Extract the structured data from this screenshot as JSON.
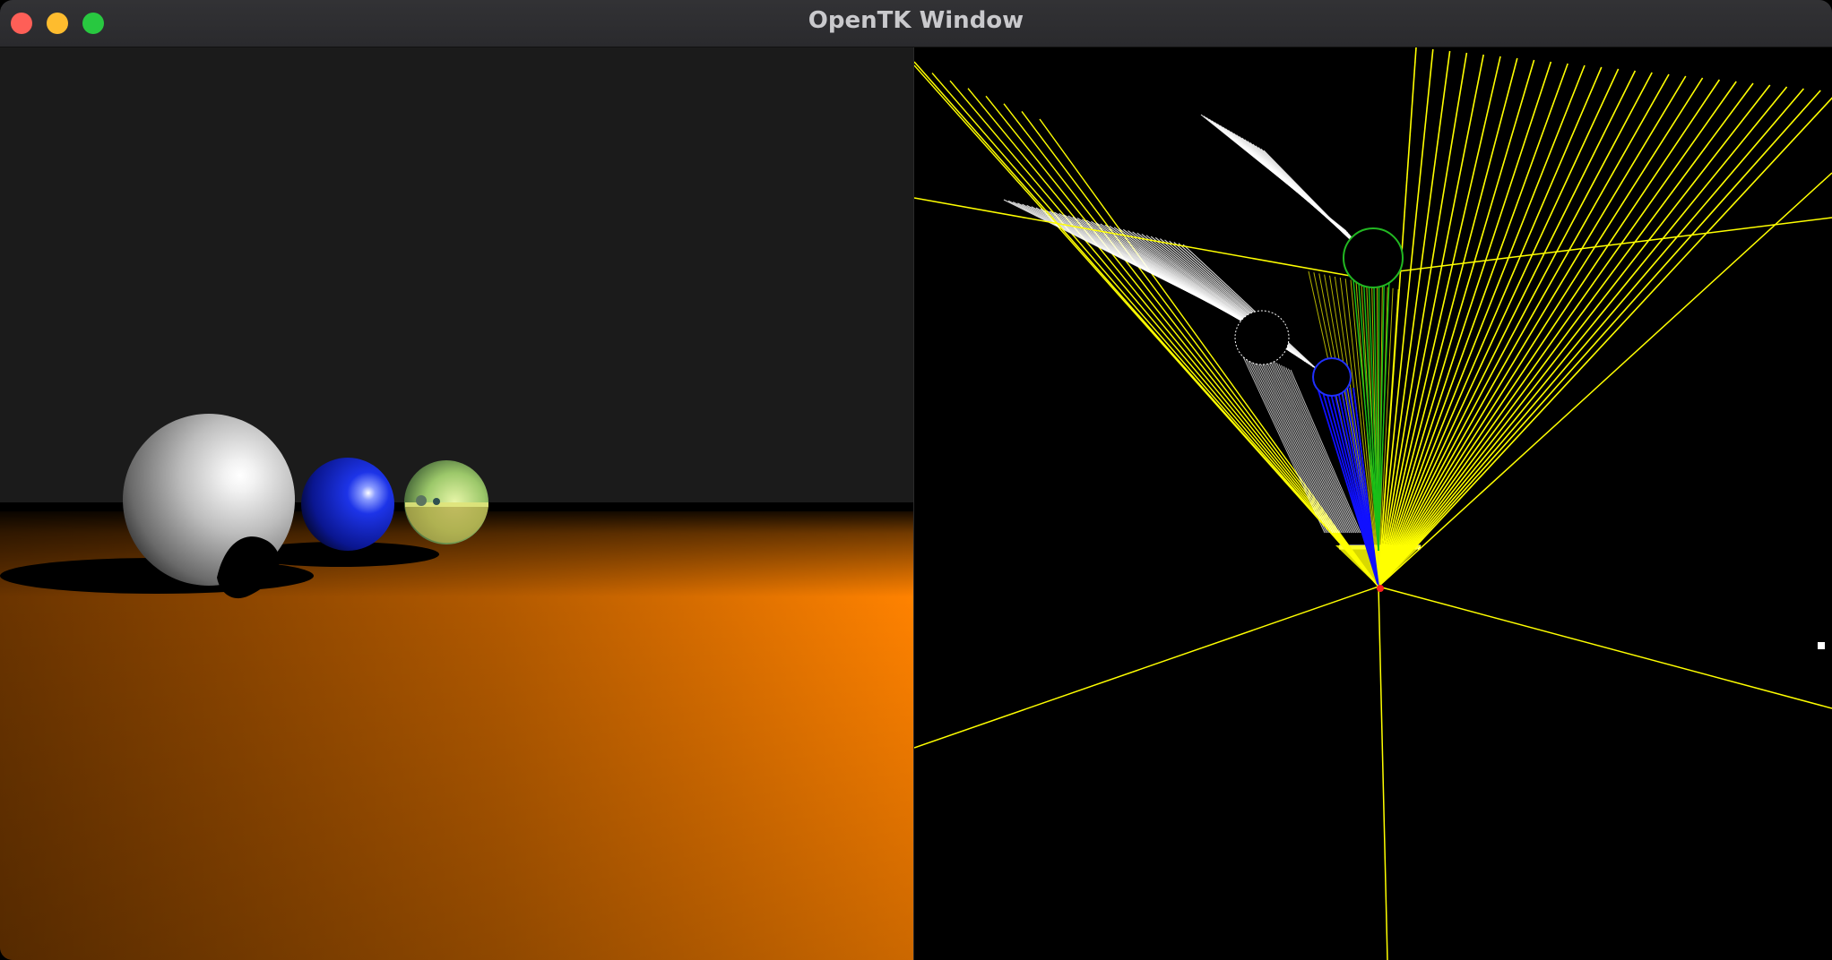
{
  "window": {
    "title": "OpenTK Window",
    "controls": [
      "close",
      "minimize",
      "zoom"
    ]
  },
  "scene": {
    "left_panel": "raytraced-render",
    "right_panel": "ray-debug-view",
    "colors": {
      "background": "#1b1b1b",
      "floor_light": "#ff8000",
      "floor_dark": "#6b3500",
      "sphere_white": "#e6e6e6",
      "sphere_blue": "#0a1fd6",
      "sphere_reflective": "#a9d07a",
      "ray_primary": "#ffff00",
      "ray_shadow": "#ffffff",
      "ray_reflect_blue": "#1010ff",
      "ray_reflect_green": "#18c018",
      "camera_marker": "#ff2020"
    }
  }
}
